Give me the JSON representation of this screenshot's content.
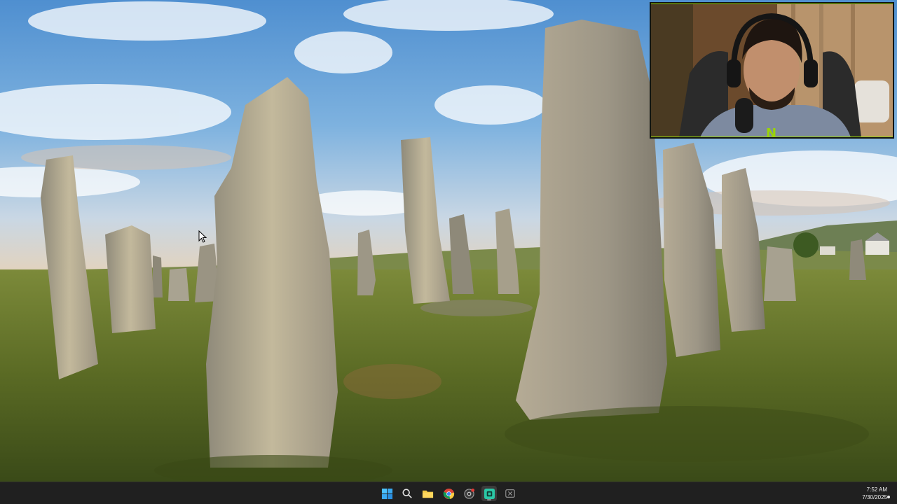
{
  "desktop": {
    "wallpaper": "standing-stones-landscape",
    "colors": {
      "sky": "#5b95cf",
      "grass": "#6b7a2a",
      "stone": "#a39d8a"
    }
  },
  "webcam_overlay": {
    "subject": "streamer-with-headset",
    "logo_glyph": "N",
    "accent_color": "#9ad30a"
  },
  "taskbar": {
    "background": "#202020",
    "icons": [
      {
        "name": "windows-start-icon"
      },
      {
        "name": "search-icon"
      },
      {
        "name": "file-explorer-icon"
      },
      {
        "name": "chrome-icon"
      },
      {
        "name": "recorder-icon"
      },
      {
        "name": "active-app-icon"
      },
      {
        "name": "xbox-icon"
      }
    ],
    "clock": {
      "time": "7:52 AM",
      "date": "7/30/2025"
    }
  }
}
